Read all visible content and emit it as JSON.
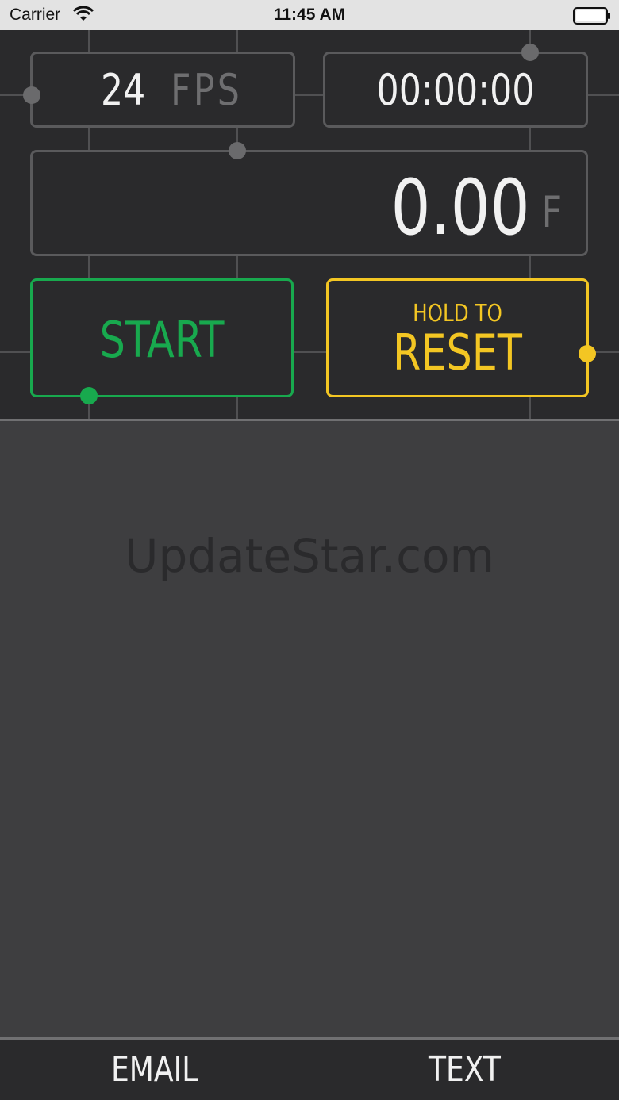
{
  "status_bar": {
    "carrier": "Carrier",
    "time": "11:45 AM",
    "wifi_icon": "wifi-icon",
    "battery_icon": "battery-icon"
  },
  "panel": {
    "fps": {
      "value": "24",
      "unit": "FPS"
    },
    "timecode": "00:00:00",
    "frames": {
      "value": "0.00",
      "unit": "F"
    },
    "start_button": {
      "label": "START"
    },
    "reset_button": {
      "label_small": "HOLD TO",
      "label_big": "RESET"
    }
  },
  "content": {
    "watermark": "UpdateStar.com"
  },
  "bottom_bar": {
    "email_label": "EMAIL",
    "text_label": "TEXT"
  },
  "colors": {
    "panel_bg": "#2a2a2c",
    "content_bg": "#3e3e40",
    "start_green": "#18a94e",
    "reset_yellow": "#f3c623",
    "border_gray": "#5a5a5c"
  }
}
